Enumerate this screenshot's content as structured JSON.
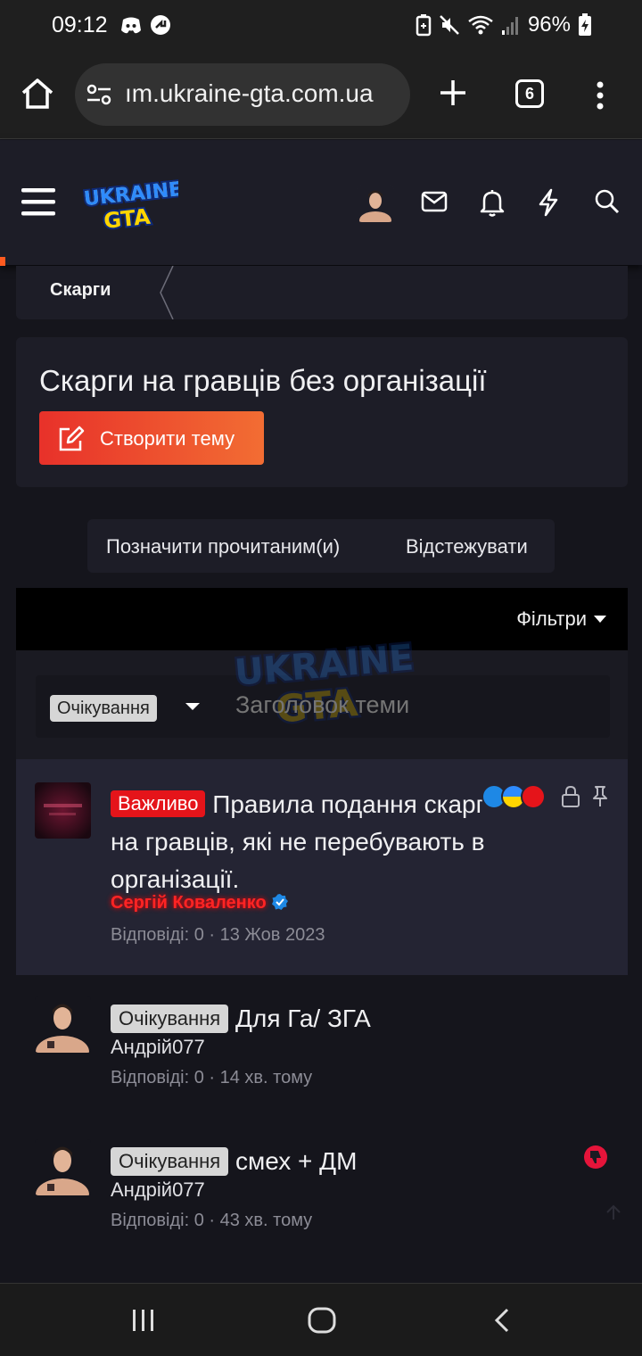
{
  "status_bar": {
    "time": "09:12",
    "battery": "96%",
    "icons_left": [
      "discord-icon",
      "arrow-badge-icon"
    ],
    "icons_right": [
      "battery-saver-icon",
      "mute-icon",
      "wifi-icon",
      "signal-icon",
      "battery-charging-icon"
    ]
  },
  "browser": {
    "url": "ım.ukraine-gta.com.ua",
    "tab_count": "6"
  },
  "site": {
    "logo_top": "UKRAINE",
    "logo_bottom": "GTA",
    "breadcrumb": "Скарги"
  },
  "forum": {
    "title": "Скарги на гравців без організації",
    "create_button": "Створити тему",
    "mark_read": "Позначити прочитаним(и)",
    "watch": "Відстежувати",
    "filters_label": "Фільтри"
  },
  "quick_filter": {
    "prefix_value": "Очікування",
    "title_placeholder": "Заголовок теми"
  },
  "threads": [
    {
      "prefix": "Важливо",
      "title": "Правила подання скарг на гравців, які не перебувають в організації.",
      "author": "Сергій Коваленко",
      "meta": "Відповіді: 0 · 13 Жов 2023",
      "sticky": true,
      "locked": true
    },
    {
      "prefix": "Очікування",
      "title": "Для Га/ ЗГА",
      "author": "Андрій077",
      "meta": "Відповіді: 0 · 14 хв. тому"
    },
    {
      "prefix": "Очікування",
      "title": "смех + ДМ",
      "author": "Андрій077",
      "meta": "Відповіді: 0 · 43 хв. тому"
    }
  ],
  "colors": {
    "accent_start": "#e8312a",
    "accent_end": "#f26d33",
    "important_badge": "#e5141a",
    "author_highlight": "#ff2424",
    "verified": "#1e88e5"
  }
}
